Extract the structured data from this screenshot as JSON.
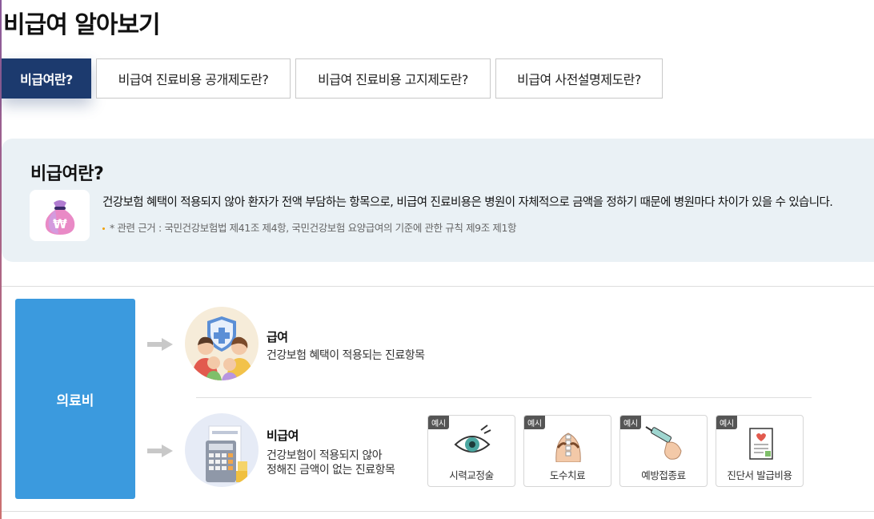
{
  "page": {
    "title": "비급여 알아보기"
  },
  "tabs": [
    {
      "label": "비급여란?",
      "active": true
    },
    {
      "label": "비급여 진료비용 공개제도란?",
      "active": false
    },
    {
      "label": "비급여 진료비용 고지제도란?",
      "active": false
    },
    {
      "label": "비급여 사전설명제도란?",
      "active": false
    }
  ],
  "info": {
    "title": "비급여란?",
    "icon": "money-bag-won-icon",
    "description": "건강보험 혜택이 적용되지 않아 환자가 전액 부담하는 항목으로, 비급여 진료비용은 병원이 자체적으로 금액을 정하기 때문에 병원마다 차이가 있을 수 있습니다.",
    "note": "* 관련 근거 : 국민건강보험법 제41조 제4항, 국민건강보험 요양급여의 기준에 관한 규칙 제9조 제1항"
  },
  "diagram": {
    "root_label": "의료비",
    "covered": {
      "title": "급여",
      "description": "건강보험 혜택이 적용되는 진료항목",
      "icon": "family-shield-icon"
    },
    "non_covered": {
      "title": "비급여",
      "description_line1": "건강보험이 적용되지 않아",
      "description_line2": "정해진 금액이 없는 진료항목",
      "icon": "calculator-receipt-icon",
      "examples": [
        {
          "badge": "예시",
          "label": "시력교정술",
          "icon": "eye-icon"
        },
        {
          "badge": "예시",
          "label": "도수치료",
          "icon": "spine-therapy-icon"
        },
        {
          "badge": "예시",
          "label": "예방접종료",
          "icon": "syringe-icon"
        },
        {
          "badge": "예시",
          "label": "진단서 발급비용",
          "icon": "medical-certificate-icon"
        }
      ]
    }
  },
  "colors": {
    "tab_active": "#1c3a6e",
    "root_box": "#3b9ade",
    "info_bg": "#eaf1f5"
  }
}
